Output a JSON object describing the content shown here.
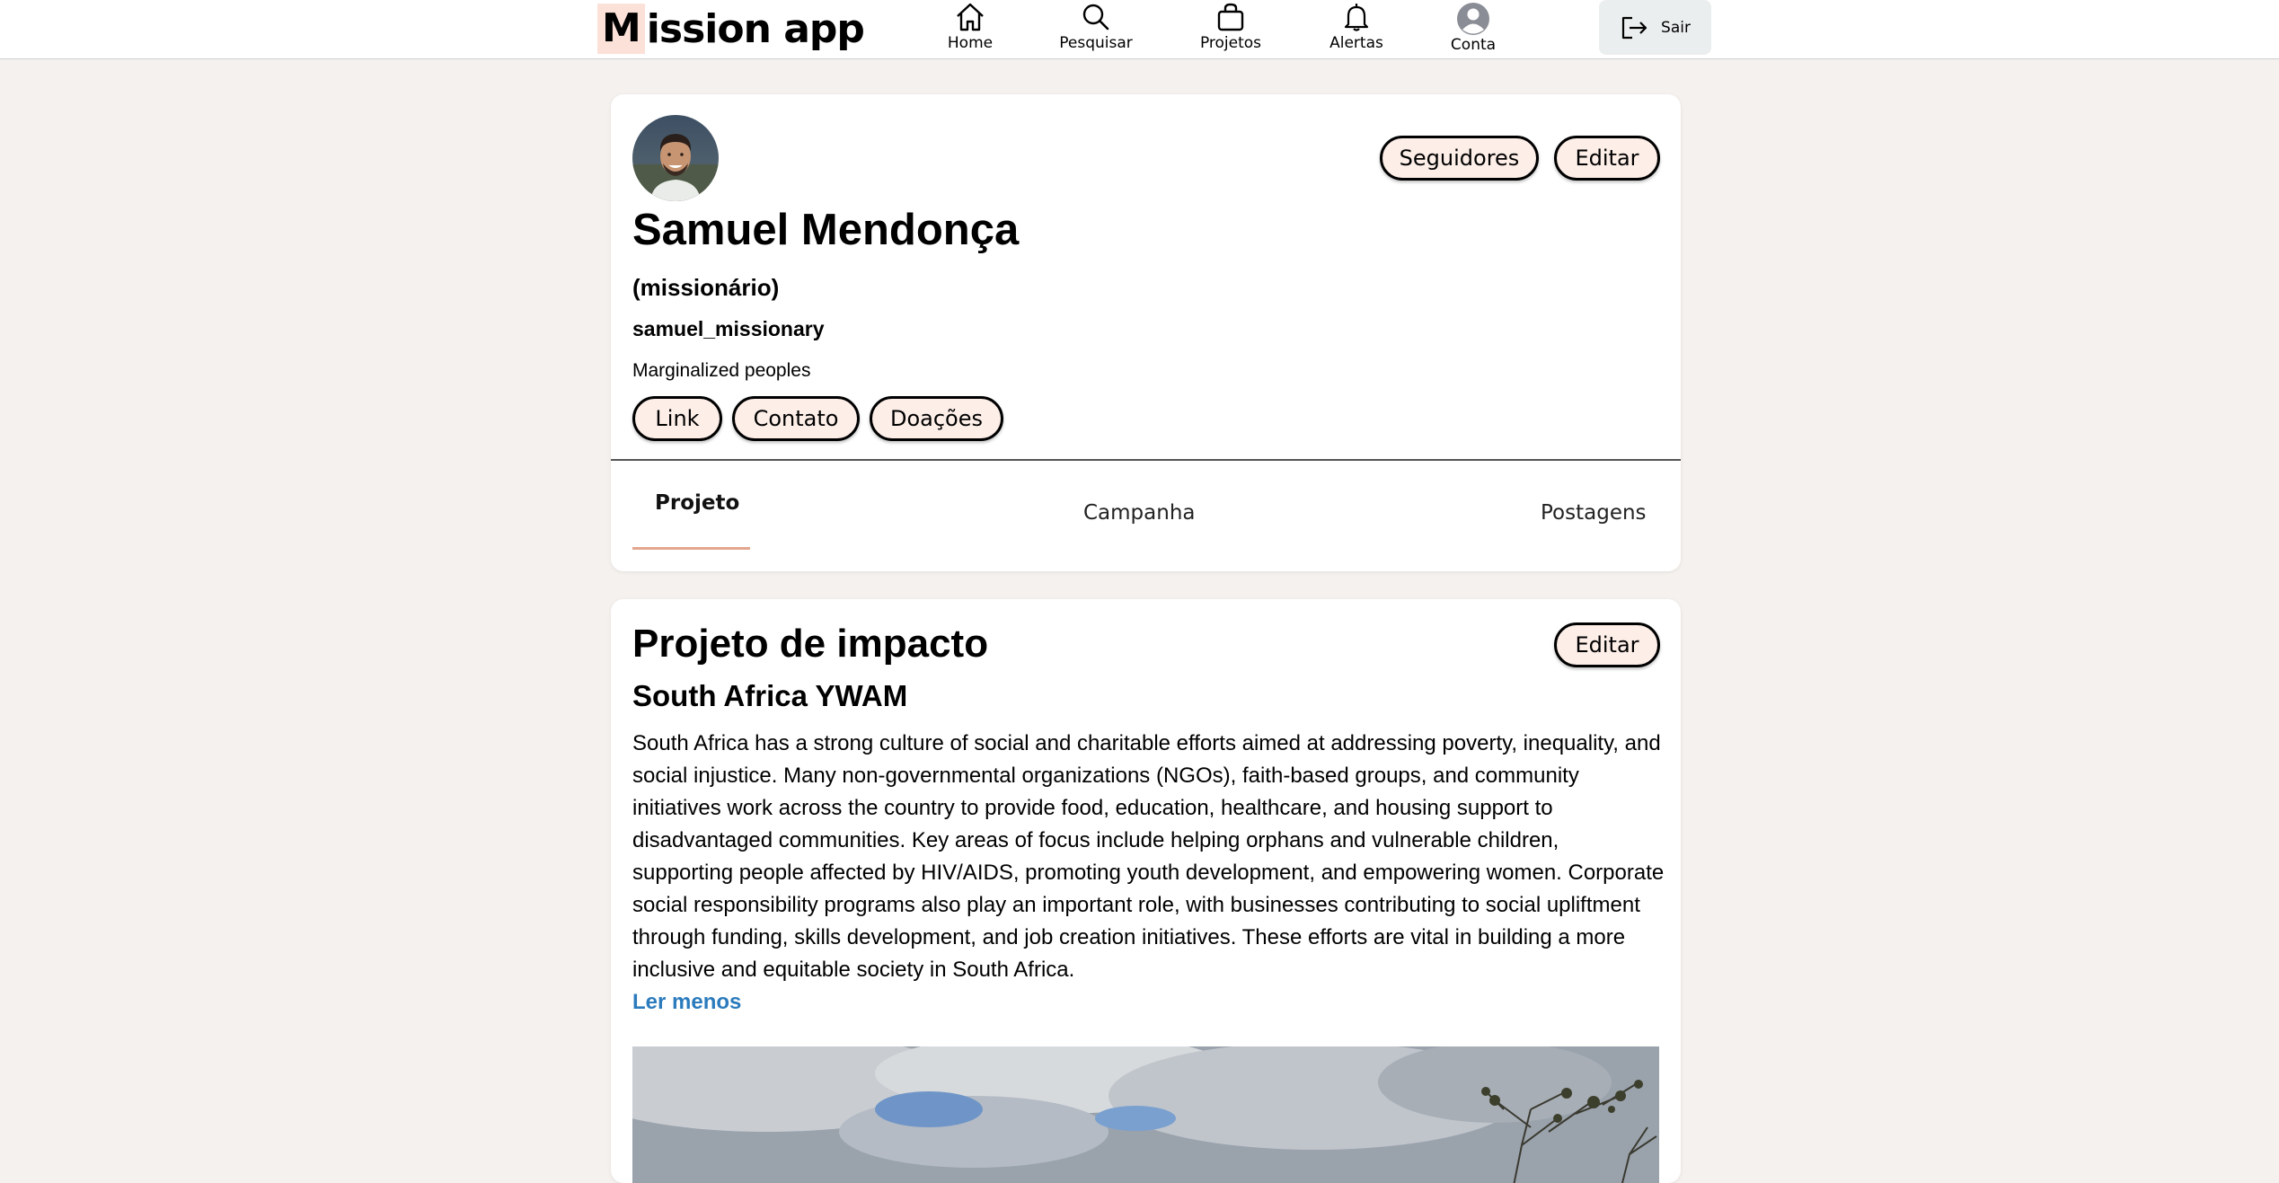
{
  "app": {
    "logo_initial": "M",
    "logo_rest": "ission app"
  },
  "nav": {
    "home": "Home",
    "search": "Pesquisar",
    "projects": "Projetos",
    "alerts": "Alertas",
    "account": "Conta",
    "logout": "Sair"
  },
  "profile": {
    "followers_button": "Seguidores",
    "edit_button": "Editar",
    "name": "Samuel Mendonça",
    "role": "(missionário)",
    "username": "samuel_missionary",
    "bio": "Marginalized peoples",
    "links": [
      "Link",
      "Contato",
      "Doações"
    ],
    "tabs": [
      "Projeto",
      "Campanha",
      "Postagens"
    ],
    "active_tab": "Projeto"
  },
  "project": {
    "title": "Projeto de impacto",
    "edit_button": "Editar",
    "name": "South Africa YWAM",
    "description": "South Africa has a strong culture of social and charitable efforts aimed at addressing poverty, inequality, and social injustice. Many non-governmental organizations (NGOs), faith-based groups, and community initiatives work across the country to provide food, education, healthcare, and housing support to disadvantaged communities. Key areas of focus include helping orphans and vulnerable children, supporting people affected by HIV/AIDS, promoting youth development, and empowering women. Corporate social responsibility programs also play an important role, with businesses contributing to social upliftment through funding, skills development, and job creation initiatives. These efforts are vital in building a more inclusive and equitable society in South Africa.",
    "read_less": "Ler menos"
  },
  "colors": {
    "page_bg": "#f5f1ee",
    "accent_pill": "#fdeee8",
    "logo_highlight": "#fbe1d8",
    "link_blue": "#2b7bbd",
    "tab_underline": "#e3a68f"
  }
}
